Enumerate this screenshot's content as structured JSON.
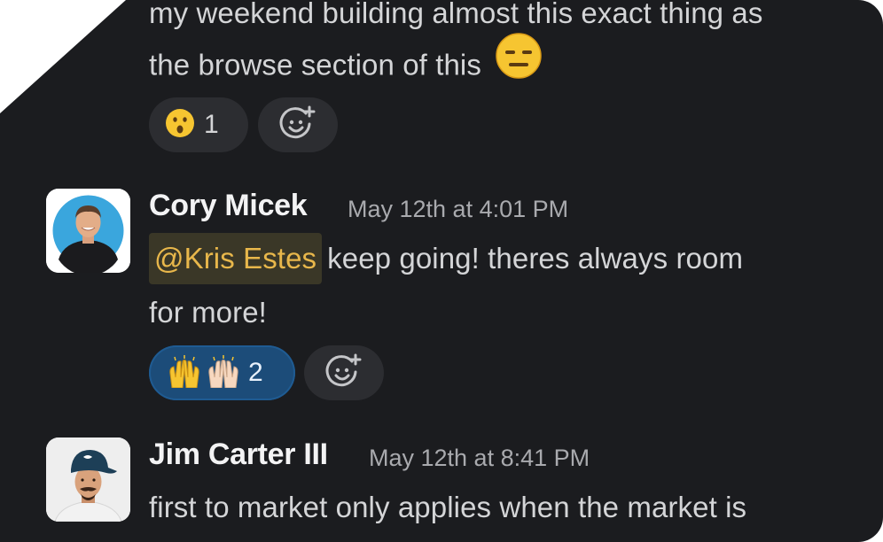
{
  "messages": [
    {
      "lines": [
        "my weekend building almost this exact thing as",
        "the browse section of this"
      ],
      "trailing_emoji": "expressionless-face",
      "reactions": [
        {
          "emoji": "hushed-face",
          "count": "1",
          "active": false
        }
      ],
      "add_reaction_icon": "add-reaction-icon"
    },
    {
      "author": "Cory Micek",
      "timestamp": "May 12th at 4:01 PM",
      "mention": "@Kris Estes",
      "text_after_mention": "keep going! theres always room",
      "text_line2": "for more!",
      "reactions": [
        {
          "emoji": [
            "raised-hands",
            "raised-hands-light"
          ],
          "count": "2",
          "active": true
        }
      ],
      "add_reaction_icon": "add-reaction-icon"
    },
    {
      "author": "Jim Carter III",
      "timestamp": "May 12th at 8:41 PM",
      "text": "first to market only applies when the market is"
    }
  ],
  "colors": {
    "background": "#1b1c1f",
    "text": "#d4d5d7",
    "mention_bg": "#3a3727",
    "mention_text": "#e8b74b",
    "reaction_active_bg": "#1c4c79",
    "reaction_bg": "#2c2d31"
  }
}
